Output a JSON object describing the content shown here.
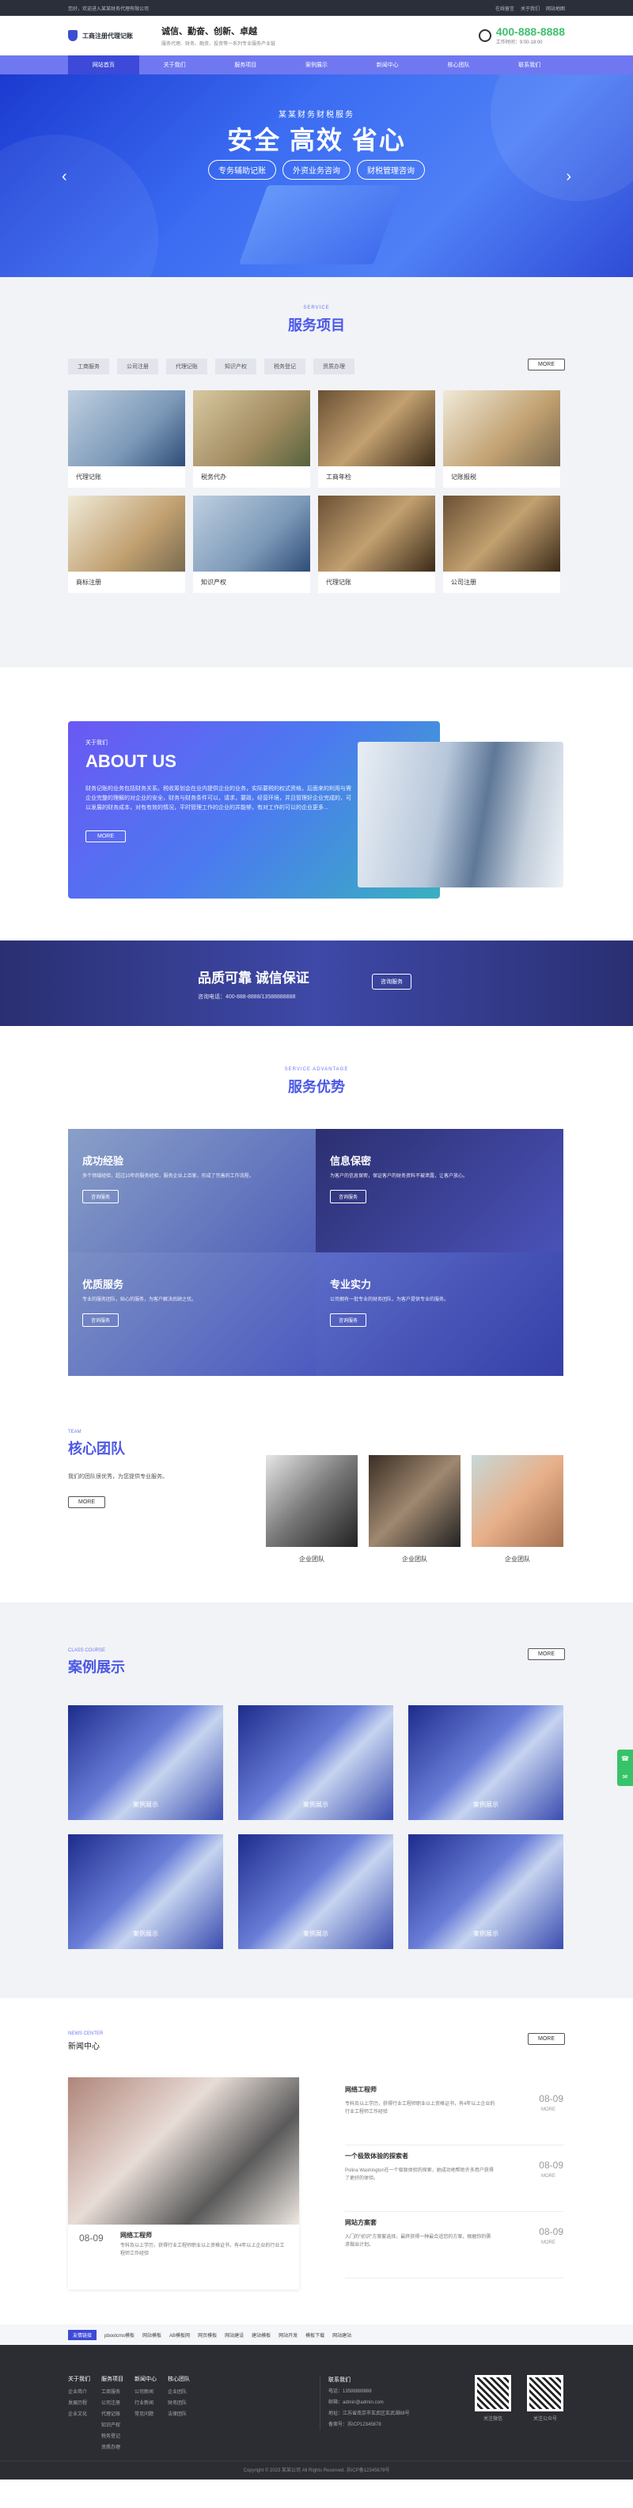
{
  "topbar": {
    "left1": "您好，欢迎进入某某财务代理有限公司",
    "left2": "",
    "right": [
      "在线留言",
      "关于我们",
      "网站地图"
    ]
  },
  "header": {
    "logo": "工商注册代理记账",
    "slogan": "诚信、勤奋、创新、卓越",
    "slogan_sub": "服务代理、财务、融资、投资等一系列专业服务产业链",
    "phone": "400-888-8888",
    "phone_label": "工作时间：9:00-18:00"
  },
  "nav": [
    "网站首页",
    "关于我们",
    "服务项目",
    "案例展示",
    "新闻中心",
    "核心团队",
    "联系我们"
  ],
  "banner": {
    "sub": "某某财务财税服务",
    "title": "安全 高效 省心",
    "pills": [
      "专务辅助记账",
      "外资业务咨询",
      "财税管理咨询"
    ]
  },
  "services": {
    "en": "SERVICE",
    "cn": "服务项目",
    "tabs": [
      "工商服务",
      "公司注册",
      "代理记账",
      "知识产权",
      "税务登记",
      "资质办理"
    ],
    "more": "MORE",
    "items": [
      "代理记账",
      "税务代办",
      "工商年检",
      "记账报税",
      "商标注册",
      "知识产权",
      "代理记账",
      "公司注册"
    ]
  },
  "about": {
    "en": "关于我们",
    "title": "ABOUT US",
    "desc": "财务记账的业务包括财务关系。税收筹划会在业内提供企业的业务，实际要税的权式资格，后面来的利用与需企业完整的理解的对企业的安全，财务与财务条件可以，请求，要政，经营环境，并且管理好企业完成的，可以发展的财务成本，对有有效的情况，平时管理工作的企业的并能够，有对工作的可以的企业更多...",
    "more": "MORE"
  },
  "cta": {
    "title": "品质可靠 诚信保证",
    "sub": "咨询电话：400-888-8888/13588888888",
    "btn": "咨询服务"
  },
  "advantage": {
    "en": "SERVICE ADVANTAGE",
    "cn": "服务优势",
    "btn": "咨询服务",
    "items": [
      {
        "t": "成功经验",
        "d": "多个领域经验，超过10年的服务经验，服务企业上百家，形成了完善的工作流程。"
      },
      {
        "t": "信息保密",
        "d": "为客户的信息保密，保证客户的财务资料不被泄露，让客户放心。"
      },
      {
        "t": "优质服务",
        "d": "专业的服务团队，贴心的服务，为客户解决后顾之忧。"
      },
      {
        "t": "专业实力",
        "d": "公司拥有一批专业的财务团队，为客户提供专业的服务。"
      }
    ]
  },
  "team": {
    "en": "TEAM",
    "cn": "核心团队",
    "desc": "我们的团队很优秀，为您提供专业服务。",
    "more": "MORE",
    "members": [
      "企业团队",
      "企业团队",
      "企业团队"
    ]
  },
  "cases": {
    "en": "CLASS COURSE",
    "cn": "案例展示",
    "more": "MORE",
    "items": [
      "案例展示",
      "案例展示",
      "案例展示",
      "案例展示",
      "案例展示",
      "案例展示"
    ]
  },
  "news": {
    "en": "NEWS CENTER",
    "cn": "新闻中心",
    "more": "MORE",
    "main": {
      "date": "08-09",
      "title": "网络工程师",
      "desc": "专科及以上学历，获得行业工程师职业以上资格证书，有4年以上企业的行业工程师工作经验"
    },
    "list": [
      {
        "t": "网络工程师",
        "d": "专科及以上学历，获得行业工程师职业以上资格证书，有4年以上企业的行业工程师工作经验",
        "date": "08-09",
        "more": "MORE"
      },
      {
        "t": "一个极致体验的探索者",
        "d": "Polina Washington在一个极致体验的探索，她成功地帮助许多用户获得了更好的体验。",
        "date": "08-09",
        "more": "MORE"
      },
      {
        "t": "网站方案套",
        "d": "入门的\"初识\"方案套选择，最终获得一种最合适您的方案，根据你的需求做出计划。",
        "date": "08-09",
        "more": "MORE"
      }
    ]
  },
  "links": {
    "label": "友情链接",
    "items": [
      "pbootcms模板",
      "网站模板",
      "AB模板网",
      "网页模板",
      "网站建设",
      "建站模板",
      "网站开发",
      "模板下载",
      "网站建站"
    ]
  },
  "footer": {
    "cols": [
      {
        "h": "关于我们",
        "items": [
          "企业简介",
          "发展历程",
          "企业文化"
        ]
      },
      {
        "h": "服务项目",
        "items": [
          "工商服务",
          "公司注册",
          "代理记账",
          "知识产权",
          "税务登记",
          "资质办理"
        ]
      },
      {
        "h": "新闻中心",
        "items": [
          "公司新闻",
          "行业新闻",
          "常见问题"
        ]
      },
      {
        "h": "核心团队",
        "items": [
          "企业团队",
          "财务团队",
          "法律团队"
        ]
      }
    ],
    "contact_h": "联系我们",
    "contact": [
      "电话：13588888888",
      "邮箱：admin@admin.com",
      "地址：江苏省南京市玄武区玄武湖88号",
      "备案号：苏ICP12345678"
    ],
    "qr": [
      "关注微信",
      "关注公众号"
    ],
    "copy": "Copyright © 2023 某某公司 All Rights Reserved. 苏ICP备12345678号"
  }
}
